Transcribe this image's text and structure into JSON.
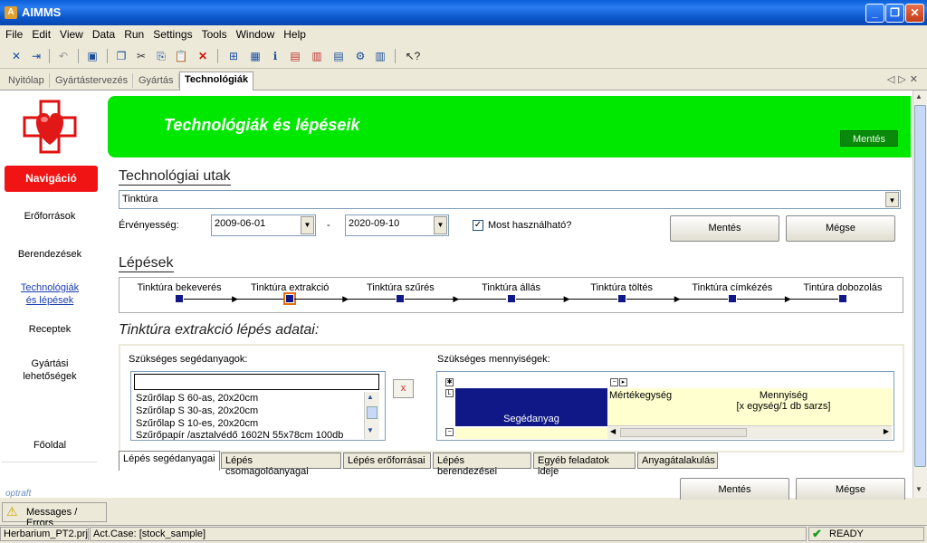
{
  "window": {
    "title": "AIMMS"
  },
  "menu": [
    "File",
    "Edit",
    "View",
    "Data",
    "Run",
    "Settings",
    "Tools",
    "Window",
    "Help"
  ],
  "tabs": [
    {
      "label": "Nyitólap",
      "active": false
    },
    {
      "label": "Gyártástervezés",
      "active": false
    },
    {
      "label": "Gyártás",
      "active": false
    },
    {
      "label": "Technológiák",
      "active": true
    }
  ],
  "sidebar": {
    "nav_button": "Navigáció",
    "items": [
      {
        "label": "Erőforrások",
        "link": false
      },
      {
        "label": "Berendezések",
        "link": false
      },
      {
        "label": "Technológiák\nés lépések",
        "link": true
      },
      {
        "label": "Receptek",
        "link": false
      },
      {
        "label": "Gyártási\nlehetőségek",
        "link": false
      },
      {
        "label": "Főoldal",
        "link": false
      }
    ],
    "logo_text": "optraft"
  },
  "header": {
    "title": "Technológiák és lépéseik",
    "save_label": "Mentés"
  },
  "paths": {
    "title": "Technológiai utak",
    "selected": "Tinktúra",
    "validity_label": "Érvényesség:",
    "date_from": "2009-06-01",
    "dash": "-",
    "date_to": "2020-09-10",
    "usable_label": "Most használható?",
    "usable_checked": true,
    "save_label": "Mentés",
    "cancel_label": "Mégse"
  },
  "steps": {
    "title": "Lépések",
    "items": [
      "Tinktúra bekeverés",
      "Tinktúra extrakció",
      "Tinktúra szűrés",
      "Tinktúra állás",
      "Tinktúra töltés",
      "Tinktúra címkézés",
      "Tintúra dobozolás"
    ],
    "current_index": 1
  },
  "step_data": {
    "title": "Tinktúra extrakció lépés adatai:",
    "aux_label": "Szükséges segédanyagok:",
    "aux_list": [
      "Szűrőlap S 60-as, 20x20cm",
      "Szűrőlap  S 30-as, 20x20cm",
      "Szűrőlap S 10-es, 20x20cm",
      "Szűrőpapír /asztalvédő 1602N 55x78cm 100db"
    ],
    "remove_label": "x",
    "qty_label": "Szükséges mennyiségek:",
    "grid": {
      "col_material": "Segédanyag",
      "col_unit": "Mértékegység",
      "col_qty": "Mennyiség",
      "col_qty_sub": "[x egység/1 db sarzs]"
    }
  },
  "bottom_tabs": [
    {
      "label": "Lépés segédanyagai",
      "active": true
    },
    {
      "label": "Lépés csomagolóanyagai",
      "active": false
    },
    {
      "label": "Lépés erőforrásai",
      "active": false
    },
    {
      "label": "Lépés berendezései",
      "active": false
    },
    {
      "label": "Egyéb feladatok ideje",
      "active": false
    },
    {
      "label": "Anyagátalakulás",
      "active": false
    }
  ],
  "footer": {
    "save_label": "Mentés",
    "cancel_label": "Mégse"
  },
  "messages": {
    "label": "Messages / Errors"
  },
  "status": {
    "project": "Herbarium_PT2.prj",
    "case": "Act.Case: [stock_sample]",
    "state": "READY"
  }
}
